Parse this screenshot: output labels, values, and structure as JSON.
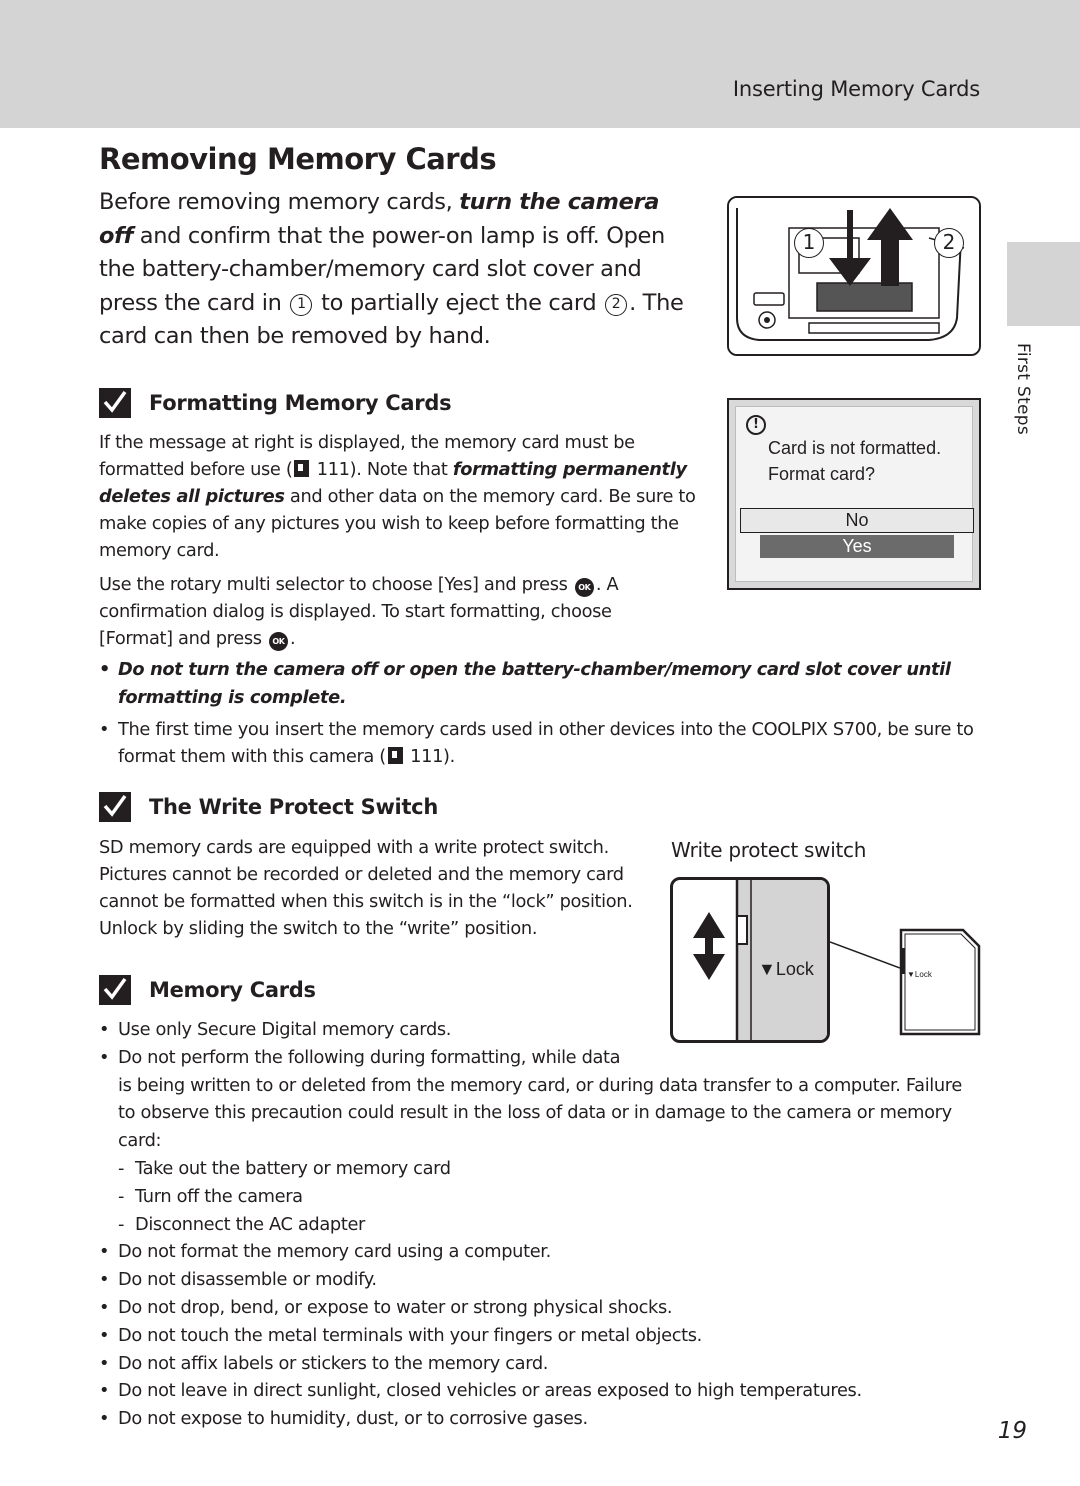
{
  "header": {
    "running_head": "Inserting Memory Cards"
  },
  "side_tab": {
    "label": "First Steps"
  },
  "page_title": "Removing Memory Cards",
  "intro": {
    "text_1": "Before removing memory cards, ",
    "emphasis": "turn the camera off",
    "text_2": " and confirm that the power-on lamp is off. Open the battery-chamber/memory card slot cover and press the card in ",
    "step_1": "1",
    "text_3": " to partially eject the card ",
    "step_2": "2",
    "text_4": ". The card can then be removed by hand."
  },
  "camera_figure": {
    "step_1_label": "1",
    "step_2_label": "2"
  },
  "formatting": {
    "heading": "Formatting Memory Cards",
    "para1_a": "If the message at right is displayed, the memory card must be formatted before use (",
    "para1_ref": "111",
    "para1_b": "). Note that ",
    "para1_bold": "formatting permanently deletes all pictures",
    "para1_c": " and other data on the memory card. Be sure to make copies of any pictures you wish to keep before formatting the memory card.",
    "para2_a": "Use the rotary multi selector to choose [Yes] and press ",
    "para2_b": ". A confirmation dialog is displayed. To start formatting, choose [Format] and press ",
    "para2_c": ".",
    "ok_label": "OK",
    "bullets": [
      "Do not turn the camera off or open the battery-chamber/memory card slot cover until formatting is complete.",
      "The first time you insert the memory cards used in other devices into the COOLPIX S700, be sure to format them with this camera ("
    ],
    "bullet2_ref": "111",
    "bullet2_end": ")."
  },
  "lcd_dialog": {
    "warning_icon": "!",
    "message_line1": "Card is not formatted.",
    "message_line2": "Format card?",
    "option_no": "No",
    "option_yes": "Yes"
  },
  "write_protect": {
    "heading": "The Write Protect Switch",
    "body": "SD memory cards are equipped with a write protect switch. Pictures cannot be recorded or deleted and the memory card cannot be formatted when this switch is in the “lock” position. Unlock by sliding the switch to the “write” position.",
    "figure_label": "Write protect switch",
    "lock_label": "▼Lock",
    "card_lock_label": "▼Lock"
  },
  "memory_cards": {
    "heading": "Memory Cards",
    "bullet1": "Use only Secure Digital memory cards.",
    "bullet2_line1": "Do not perform the following during formatting, while data",
    "bullet2_rest": "is being written to or deleted from the memory card, or during data transfer to a computer. Failure to observe this precaution could result in the loss of data or in damage to the camera or memory card:",
    "sub_items": [
      "Take out the battery or memory card",
      "Turn off the camera",
      "Disconnect the AC adapter"
    ],
    "bullets_rest": [
      "Do not format the memory card using a computer.",
      "Do not disassemble or modify.",
      "Do not drop, bend, or expose to water or strong physical shocks.",
      "Do not touch the metal terminals with your fingers or metal objects.",
      "Do not affix labels or stickers to the memory card.",
      "Do not leave in direct sunlight, closed vehicles or areas exposed to high temperatures.",
      "Do not expose to humidity, dust, or to corrosive gases."
    ]
  },
  "page_number": "19"
}
